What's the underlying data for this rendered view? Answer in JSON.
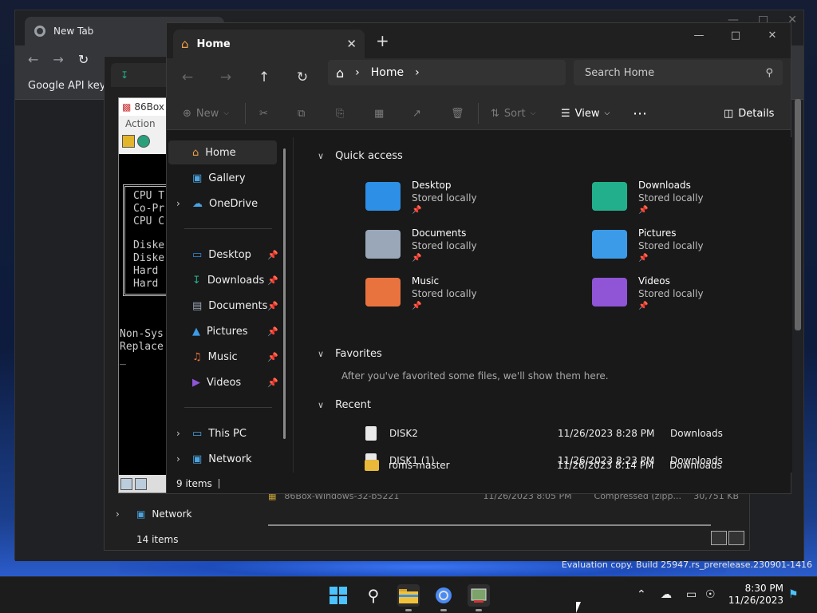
{
  "desktop": {
    "evaluation_text": "Evaluation copy. Build 25947.rs_prerelease.230901-1416"
  },
  "chrome_window": {
    "tab_title": "New Tab",
    "bookmark": "Google API keys"
  },
  "explorer_behind": {
    "network_label": "Network",
    "status": "14 items",
    "file_name": "86Box-Windows-32-b5221",
    "file_date": "11/26/2023 8:05 PM",
    "file_type": "Compressed (zipp...",
    "file_size": "30,751 KB"
  },
  "box86": {
    "title": "86Box",
    "menu": "Action",
    "screen_lines": [
      "CPU T",
      "Co-Pr",
      "CPU C",
      "Diske",
      "Diske",
      "Hard ",
      "Hard "
    ],
    "screen_msg1": "Non-Sys",
    "screen_msg2": "Replace",
    "screen_cursor": "_"
  },
  "explorer": {
    "tab_title": "Home",
    "address": {
      "crumb": "Home",
      "search_placeholder": "Search Home"
    },
    "commands": {
      "new": "New",
      "sort": "Sort",
      "view": "View",
      "details": "Details"
    },
    "nav": {
      "home": "Home",
      "gallery": "Gallery",
      "onedrive": "OneDrive",
      "desktop": "Desktop",
      "downloads": "Downloads",
      "documents": "Documents",
      "pictures": "Pictures",
      "music": "Music",
      "videos": "Videos",
      "this_pc": "This PC",
      "network": "Network"
    },
    "sections": {
      "quick_access": "Quick access",
      "favorites": "Favorites",
      "favorites_empty": "After you've favorited some files, we'll show them here.",
      "recent": "Recent"
    },
    "quick_access": [
      {
        "name": "Desktop",
        "sub": "Stored locally",
        "color": "#2d8fe6"
      },
      {
        "name": "Downloads",
        "sub": "Stored locally",
        "color": "#22b08c"
      },
      {
        "name": "Documents",
        "sub": "Stored locally",
        "color": "#9aa7b8"
      },
      {
        "name": "Pictures",
        "sub": "Stored locally",
        "color": "#3b9be8"
      },
      {
        "name": "Music",
        "sub": "Stored locally",
        "color": "#e8733f"
      },
      {
        "name": "Videos",
        "sub": "Stored locally",
        "color": "#8f55d6"
      }
    ],
    "recent": [
      {
        "name": "DISK2",
        "date": "11/26/2023 8:28 PM",
        "location": "Downloads"
      },
      {
        "name": "DISK1 (1)",
        "date": "11/26/2023 8:23 PM",
        "location": "Downloads"
      },
      {
        "name": "roms-master",
        "date": "11/26/2023 8:14 PM",
        "location": "Downloads"
      }
    ],
    "status": "9 items"
  },
  "taskbar": {
    "time": "8:30 PM",
    "date": "11/26/2023"
  }
}
